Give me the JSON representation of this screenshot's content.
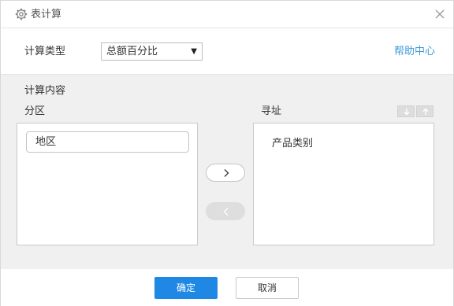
{
  "dialog": {
    "title": "表计算",
    "icons": {
      "title_icon": "gear-icon",
      "close_icon": "close-icon"
    }
  },
  "calc_type": {
    "label": "计算类型",
    "selected": "总额百分比",
    "help_link": "帮助中心"
  },
  "content": {
    "section_title": "计算内容",
    "partition": {
      "label": "分区",
      "fields": [
        "地区"
      ]
    },
    "address": {
      "label": "寻址",
      "fields": [
        "产品类别"
      ]
    },
    "icons": {
      "move_right": "chevron-right-icon",
      "move_left": "chevron-left-icon",
      "sort_down": "arrow-down-icon",
      "sort_up": "arrow-up-icon"
    }
  },
  "footer": {
    "ok": "确定",
    "cancel": "取消"
  },
  "colors": {
    "accent": "#1f88e5",
    "link": "#3c9ad8",
    "panel_bg": "#f0f0f0"
  }
}
